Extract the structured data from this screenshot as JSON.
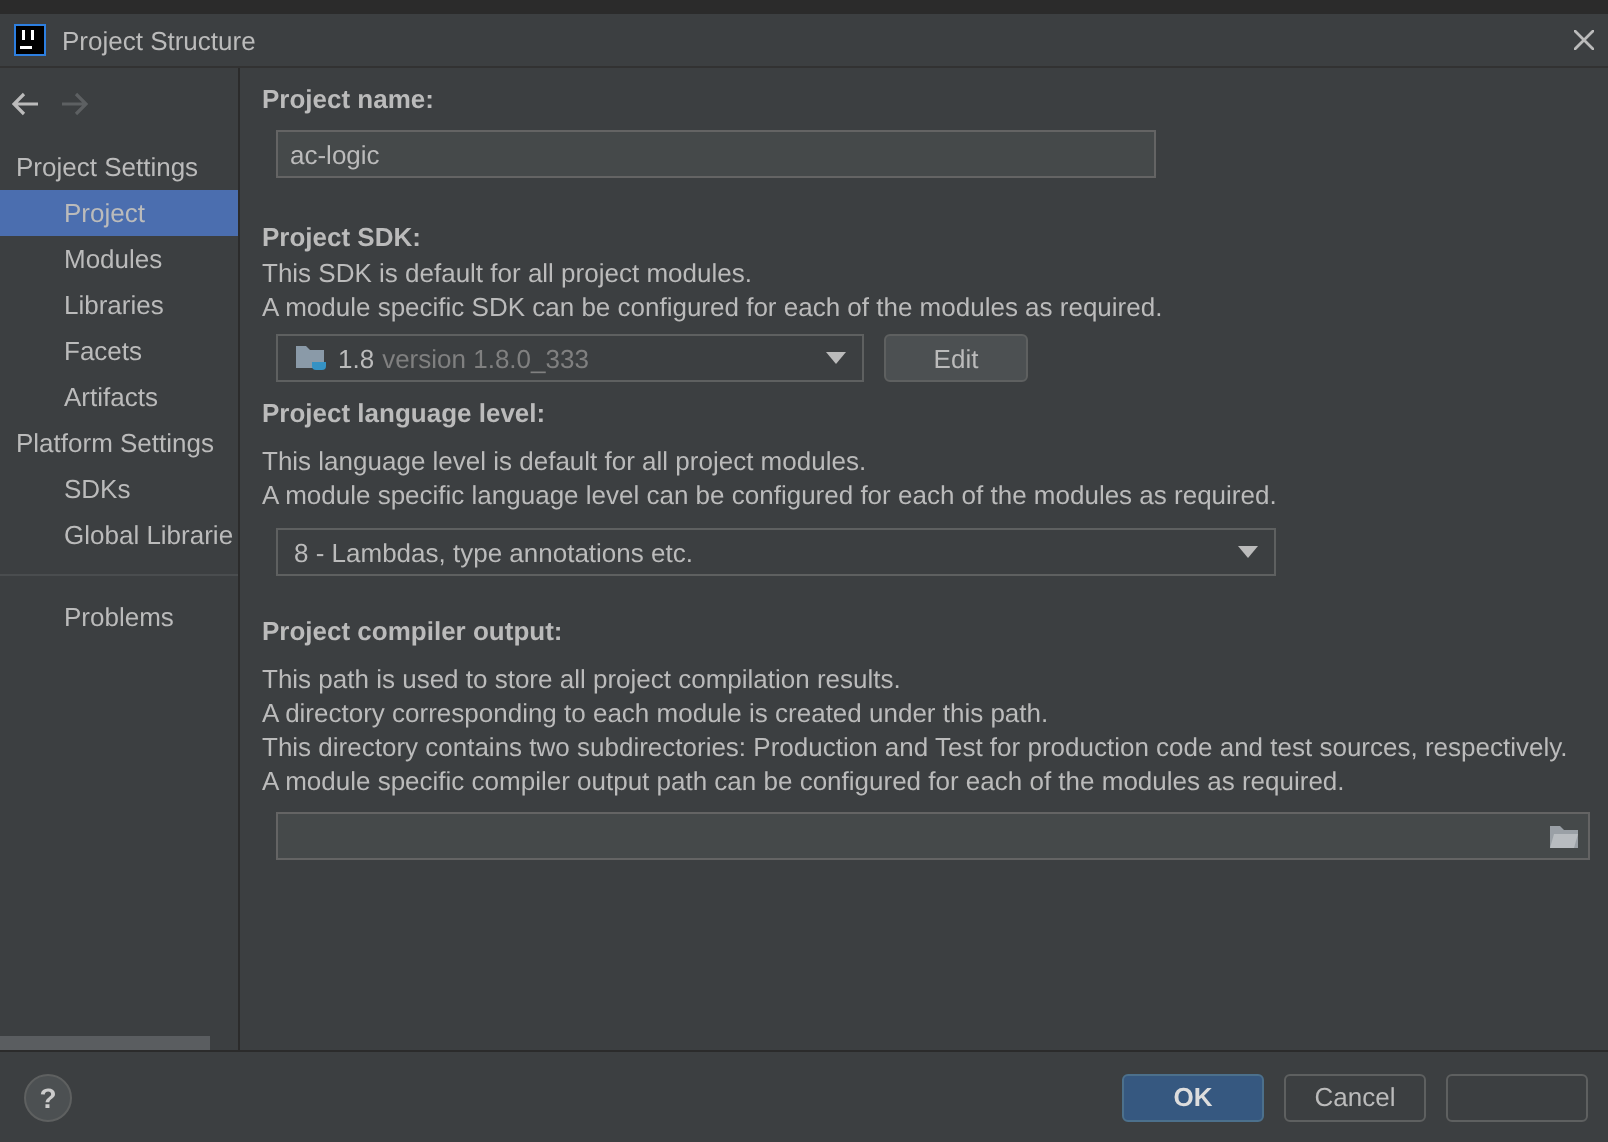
{
  "window": {
    "title": "Project Structure"
  },
  "sidebar": {
    "sections": [
      {
        "header": "Project Settings",
        "items": [
          {
            "label": "Project",
            "selected": true
          },
          {
            "label": "Modules",
            "selected": false
          },
          {
            "label": "Libraries",
            "selected": false
          },
          {
            "label": "Facets",
            "selected": false
          },
          {
            "label": "Artifacts",
            "selected": false
          }
        ]
      },
      {
        "header": "Platform Settings",
        "items": [
          {
            "label": "SDKs",
            "selected": false
          },
          {
            "label": "Global Librarie",
            "selected": false
          }
        ]
      },
      {
        "items": [
          {
            "label": "Problems",
            "selected": false
          }
        ]
      }
    ]
  },
  "project_name": {
    "label": "Project name:",
    "value": "ac-logic"
  },
  "project_sdk": {
    "label": "Project SDK:",
    "description": [
      "This SDK is default for all project modules.",
      "A module specific SDK can be configured for each of the modules as required."
    ],
    "sdk_name": "1.8",
    "sdk_version": "version 1.8.0_333",
    "edit_button": "Edit"
  },
  "language_level": {
    "label": "Project language level:",
    "description": [
      "This language level is default for all project modules.",
      "A module specific language level can be configured for each of the modules as required."
    ],
    "value": "8 - Lambdas, type annotations etc."
  },
  "compiler_output": {
    "label": "Project compiler output:",
    "description": [
      "This path is used to store all project compilation results.",
      "A directory corresponding to each module is created under this path.",
      "This directory contains two subdirectories: Production and Test for production code and test sources, respectively.",
      "A module specific compiler output path can be configured for each of the modules as required."
    ]
  },
  "footer": {
    "help": "?",
    "buttons": [
      {
        "label": "OK",
        "kind": "primary"
      },
      {
        "label": "Cancel",
        "kind": "normal"
      },
      {
        "kind": "normal"
      }
    ]
  }
}
